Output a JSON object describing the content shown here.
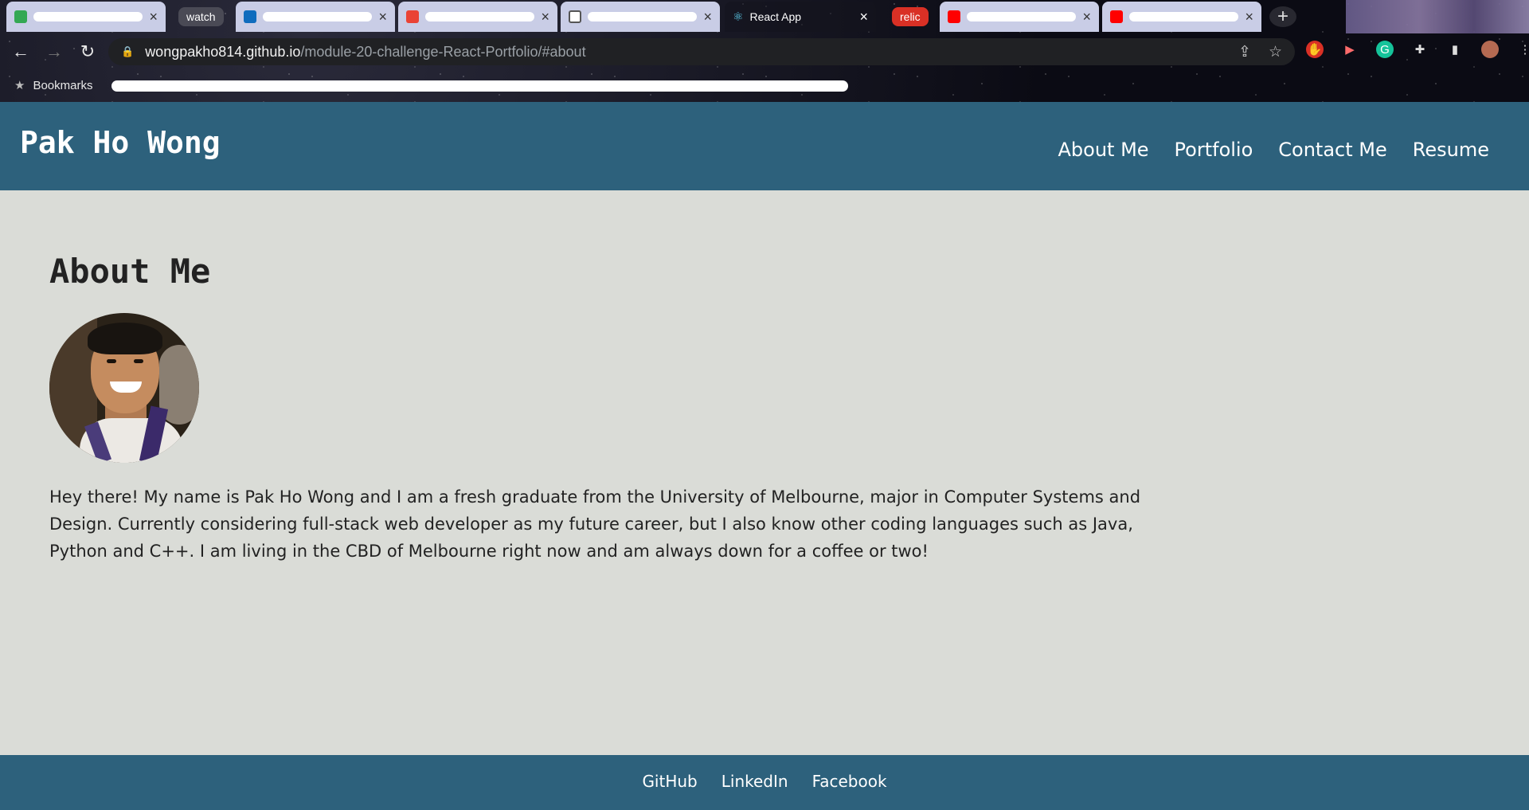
{
  "browser": {
    "tabs": [
      {
        "label": "",
        "favicon": "gmail-icon"
      },
      {
        "label": "watch",
        "type": "group-chip",
        "color": "#4a4a55"
      },
      {
        "label": "",
        "favicon": "outlook-icon"
      },
      {
        "label": "",
        "favicon": "mail-icon"
      },
      {
        "label": "",
        "favicon": "google-icon"
      },
      {
        "label": "React App",
        "favicon": "react-icon",
        "active": true
      },
      {
        "label": "relic",
        "type": "group-chip",
        "color": "#d93025"
      },
      {
        "label": "",
        "favicon": "youtube-icon"
      },
      {
        "label": "",
        "favicon": "youtube-icon"
      }
    ],
    "url_host": "wongpakho814.github.io",
    "url_path": "/module-20-challenge-React-Portfolio/#about",
    "bookmarks_label": "Bookmarks"
  },
  "site": {
    "logo": "Pak Ho Wong",
    "nav": [
      "About Me",
      "Portfolio",
      "Contact Me",
      "Resume"
    ],
    "section_title": "About Me",
    "bio": "Hey there! My name is Pak Ho Wong and I am a fresh graduate from the University of Melbourne, major in Computer Systems and Design. Currently considering full-stack web developer as my future career, but I also know other coding languages such as Java, Python and C++. I am living in the CBD of Melbourne right now and am always down for a coffee or two!",
    "footer_links": [
      "GitHub",
      "LinkedIn",
      "Facebook"
    ]
  },
  "colors": {
    "header_bg": "#2d617c",
    "page_bg": "#dadcd7",
    "relic_chip": "#d93025"
  }
}
